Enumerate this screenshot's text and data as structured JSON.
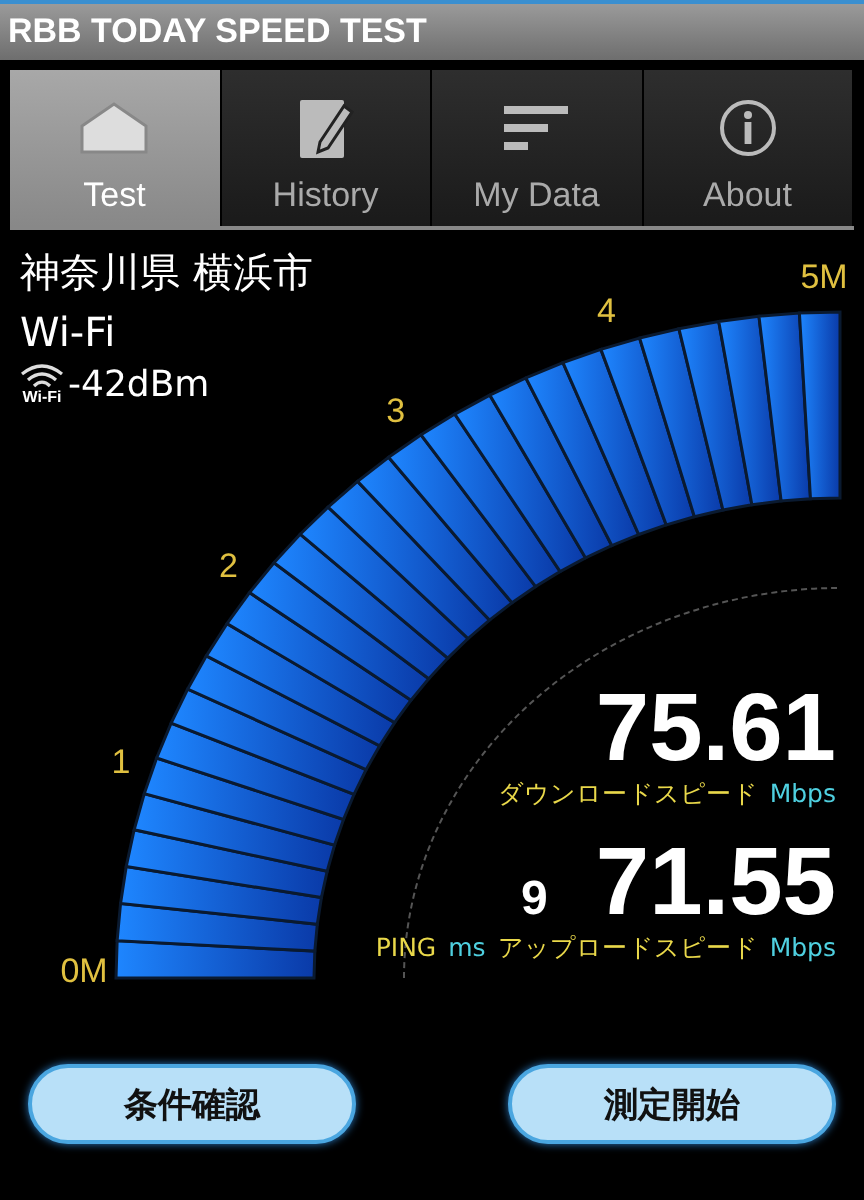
{
  "app_bar": {
    "title": "RBB TODAY SPEED TEST"
  },
  "tabs": [
    {
      "label": "Test",
      "selected": true
    },
    {
      "label": "History",
      "selected": false
    },
    {
      "label": "My Data",
      "selected": false
    },
    {
      "label": "About",
      "selected": false
    }
  ],
  "location": "神奈川県 横浜市",
  "network": "Wi-Fi",
  "signal": {
    "icon_label": "Wi-Fi",
    "reading": "-42dBm"
  },
  "gauge": {
    "ticks": [
      "0M",
      "1",
      "2",
      "3",
      "4",
      "5M"
    ]
  },
  "download": {
    "value": "75.61",
    "label": "ダウンロードスピード",
    "unit": "Mbps"
  },
  "ping": {
    "value": "9",
    "label": "PING",
    "unit": "ms"
  },
  "upload": {
    "value": "71.55",
    "label": "アップロードスピード",
    "unit": "Mbps"
  },
  "buttons": [
    {
      "label": "条件確認"
    },
    {
      "label": "測定開始"
    }
  ]
}
